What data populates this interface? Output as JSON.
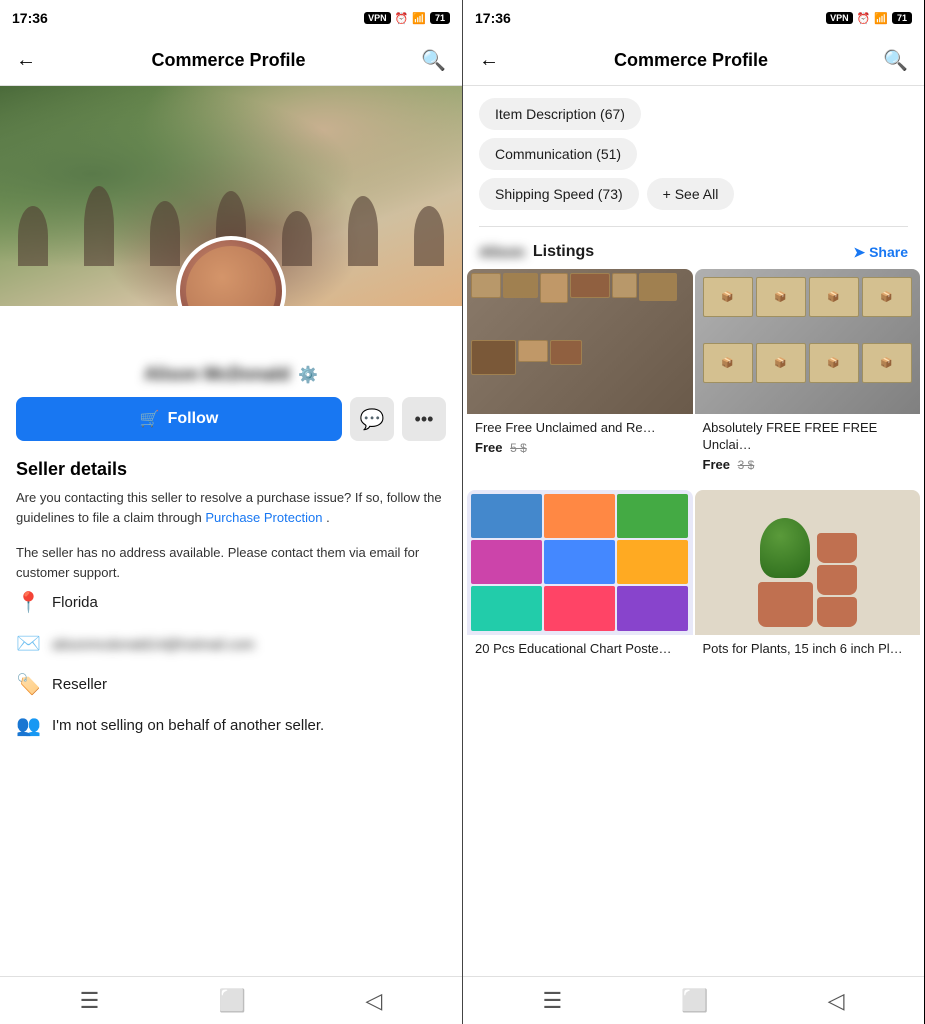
{
  "left": {
    "status": {
      "time": "17:36",
      "icons": "VPN 🕐 📶 🔋 71"
    },
    "nav": {
      "back": "←",
      "title": "Commerce Profile",
      "search": "🔍"
    },
    "profile": {
      "name": "Alison McDonald",
      "follow_label": "Follow",
      "follow_icon": "🛒",
      "messenger_icon": "💬",
      "more_icon": "•••"
    },
    "seller_details": {
      "heading": "Seller details",
      "desc1": "Are you contacting this seller to resolve a purchase issue? If so, follow the guidelines to file a claim through",
      "link": "Purchase Protection",
      "desc1_end": ".",
      "desc2": "The seller has no address available. Please contact them via email for customer support.",
      "location_label": "Florida",
      "email_label": "alisonmcdonald14@hotmail.com",
      "type_label": "Reseller",
      "behalf_label": "I'm not selling on behalf of another seller."
    },
    "bottom": {
      "menu": "☰",
      "home": "⬜",
      "back_arrow": "◁"
    }
  },
  "right": {
    "status": {
      "time": "17:36",
      "icons": "VPN 🕐 📶 🔋 71"
    },
    "nav": {
      "back": "←",
      "title": "Commerce Profile",
      "search": "🔍"
    },
    "chips": [
      {
        "label": "Item Description (67)"
      },
      {
        "label": "Communication (51)"
      },
      {
        "label": "Shipping Speed (73)"
      }
    ],
    "see_all": "+ See All",
    "listings": {
      "seller_name_blur": "Alison",
      "label": "Listings",
      "share": "Share"
    },
    "items": [
      {
        "title": "Free Free Unclaimed and Re…",
        "price_main": "Free",
        "price_strike": "5 $",
        "img_type": "boxes"
      },
      {
        "title": "Absolutely FREE FREE FREE Unclai…",
        "price_main": "Free",
        "price_strike": "3 $",
        "img_type": "amazon"
      },
      {
        "title": "20 Pcs Educational Chart Poste…",
        "price_main": "",
        "price_strike": "",
        "img_type": "posters"
      },
      {
        "title": "Pots for Plants, 15 inch 6 inch Pl…",
        "price_main": "",
        "price_strike": "",
        "img_type": "pots"
      }
    ],
    "bottom": {
      "menu": "☰",
      "home": "⬜",
      "back_arrow": "◁"
    }
  }
}
